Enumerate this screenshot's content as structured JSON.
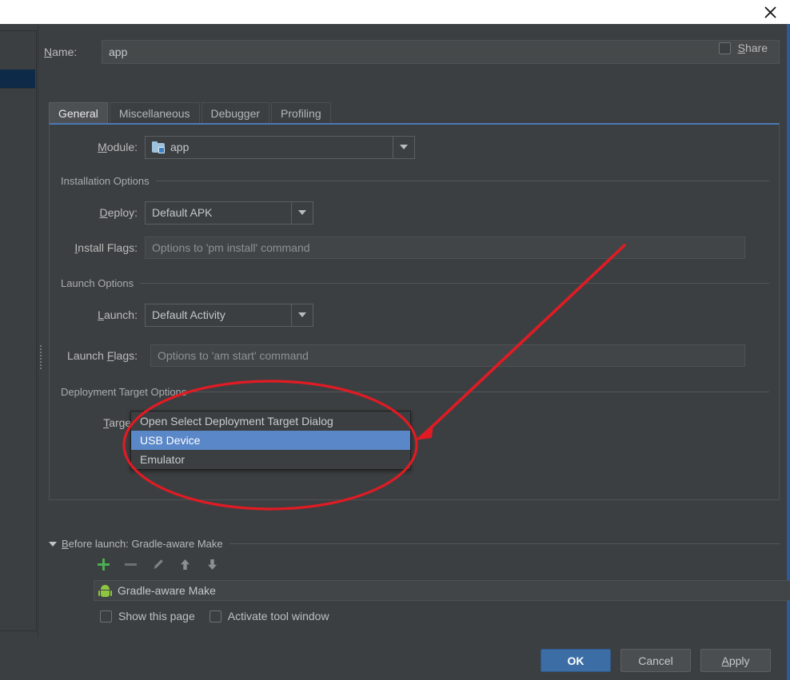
{
  "titlebar": {
    "close_icon": "close-icon"
  },
  "name_row": {
    "label": "Name:",
    "label_mnemonic": "N",
    "value": "app",
    "share_label": "Share",
    "share_mnemonic": "S",
    "share_checked": false
  },
  "tabs": [
    {
      "label": "General",
      "active": true
    },
    {
      "label": "Miscellaneous",
      "active": false
    },
    {
      "label": "Debugger",
      "active": false
    },
    {
      "label": "Profiling",
      "active": false
    }
  ],
  "general": {
    "module": {
      "label": "Module:",
      "mnemonic": "M",
      "value": "app",
      "icon": "module-folder-icon"
    },
    "installation_options": {
      "section_title": "Installation Options",
      "deploy": {
        "label": "Deploy:",
        "mnemonic": "D",
        "value": "Default APK"
      },
      "install_flags": {
        "label": "Install Flags:",
        "mnemonic": "I",
        "placeholder": "Options to 'pm install' command",
        "value": ""
      }
    },
    "launch_options": {
      "section_title": "Launch Options",
      "launch": {
        "label": "Launch:",
        "mnemonic": "L",
        "value": "Default Activity"
      },
      "launch_flags": {
        "label": "Launch Flags:",
        "mnemonic": "F",
        "placeholder": "Options to 'am start' command",
        "value": ""
      }
    },
    "deployment_target_options": {
      "section_title": "Deployment Target Options",
      "target": {
        "label": "Target:",
        "mnemonic": "T",
        "value": "USB Device"
      },
      "dropdown_open": true,
      "dropdown_items": [
        {
          "label": "Open Select Deployment Target Dialog",
          "selected": false
        },
        {
          "label": "USB Device",
          "selected": true
        },
        {
          "label": "Emulator",
          "selected": false
        }
      ]
    }
  },
  "before_launch": {
    "title": "Before launch: Gradle-aware Make",
    "mnemonic": "B",
    "expanded": true,
    "toolbar": [
      {
        "name": "add-button",
        "icon": "plus-icon",
        "enabled": true
      },
      {
        "name": "remove-button",
        "icon": "minus-icon",
        "enabled": false
      },
      {
        "name": "edit-button",
        "icon": "pencil-icon",
        "enabled": false
      },
      {
        "name": "move-up-button",
        "icon": "arrow-up-icon",
        "enabled": true
      },
      {
        "name": "move-down-button",
        "icon": "arrow-down-icon",
        "enabled": true
      }
    ],
    "items": [
      {
        "label": "Gradle-aware Make",
        "icon": "android-icon"
      }
    ],
    "checkboxes": [
      {
        "label": "Show this page",
        "checked": false
      },
      {
        "label": "Activate tool window",
        "checked": false
      }
    ]
  },
  "footer": {
    "ok": "OK",
    "cancel": "Cancel",
    "apply": "Apply",
    "apply_mnemonic": "A"
  },
  "annotation": {
    "color": "#e01b24",
    "ellipse": "highlight-ellipse",
    "arrow": "pointer-arrow"
  },
  "colors": {
    "background": "#3c3f41",
    "accent_blue": "#4b7ab3",
    "selection_blue": "#5a87c7",
    "primary_button": "#3c6ea5",
    "annotation_red": "#e01b24",
    "android_green": "#8ec63f"
  }
}
